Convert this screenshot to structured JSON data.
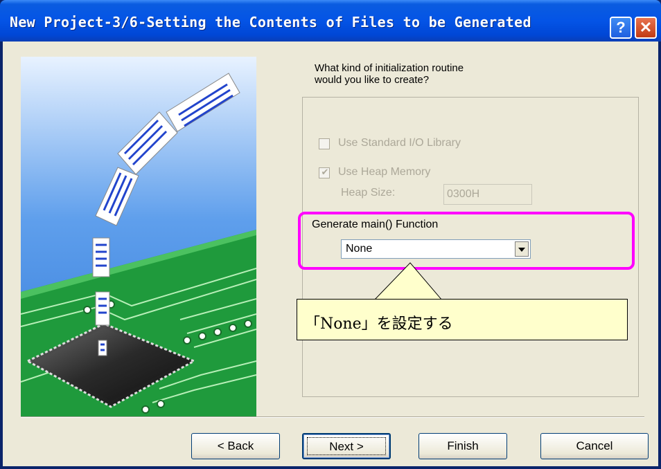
{
  "window": {
    "title": "New Project-3/6-Setting the Contents of Files to be Generated",
    "help_glyph": "?",
    "close_glyph": "✕"
  },
  "prompt": "What kind of initialization routine\nwould you like to create?",
  "options": {
    "use_stdio": {
      "label": "Use Standard I/O Library",
      "checked": false,
      "enabled": false
    },
    "use_heap": {
      "label": "Use Heap Memory",
      "checked": true,
      "enabled": false
    },
    "heap_size": {
      "label": "Heap Size:",
      "value": "0300H"
    }
  },
  "generate_main": {
    "label": "Generate main() Function",
    "selected": "None"
  },
  "callout": {
    "text": "「None」を設定する"
  },
  "buttons": {
    "back": "< Back",
    "next": "Next >",
    "finish": "Finish",
    "cancel": "Cancel"
  },
  "colors": {
    "title_bar": "#0454e6",
    "dialog_bg": "#ece9d8",
    "highlight": "#ff00ff",
    "callout_bg": "#ffffcc",
    "circuit_green": "#1f9a3c",
    "sky_blue": "#2f78d8"
  }
}
